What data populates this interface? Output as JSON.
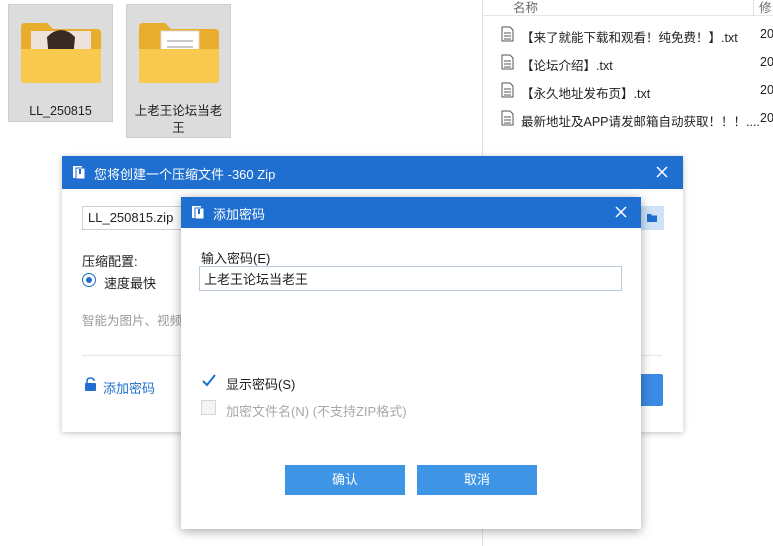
{
  "explorer": {
    "folders": [
      {
        "label": "LL_250815",
        "thumbnail": "photo-thumbnail"
      },
      {
        "label_line1": "上老王论坛当老",
        "label_line2": "王",
        "thumbnail": "document-thumbnail"
      }
    ],
    "columns": {
      "name": "名称",
      "date": "修"
    },
    "files": [
      {
        "name": "【来了就能下载和观看！纯免费！】.txt",
        "date": "20"
      },
      {
        "name": "【论坛介绍】.txt",
        "date": "20"
      },
      {
        "name": "【永久地址发布页】.txt",
        "date": "20"
      },
      {
        "name": "最新地址及APP请发邮箱自动获取！！！....",
        "date": "20"
      }
    ],
    "folder_color": "#f5c242"
  },
  "zip_dialog": {
    "title": "您将创建一个压缩文件 -360 Zip",
    "filename": "LL_250815.zip",
    "config_label": "压缩配置:",
    "option_label": "速度最快",
    "hint": "智能为图片、视频",
    "add_password_link": "添加密码",
    "accent": "#1e6fd0"
  },
  "password_dialog": {
    "title": "添加密码",
    "input_label": "输入密码(E)",
    "password_value": "上老王论坛当老王",
    "show_password_label": "显示密码(S)",
    "show_password_checked": true,
    "encrypt_names_label": "加密文件名(N) (不支持ZIP格式)",
    "encrypt_names_enabled": false,
    "confirm_label": "确认",
    "cancel_label": "取消",
    "button_color": "#3e95e6"
  }
}
